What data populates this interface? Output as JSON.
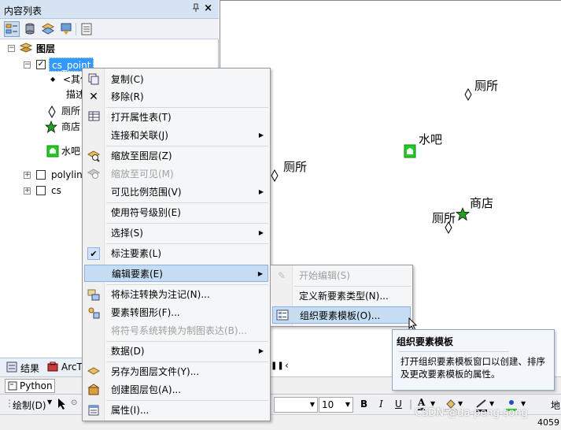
{
  "toc": {
    "title": "内容列表",
    "pin_icon": "pin-icon",
    "close_glyph": "×",
    "layers_root": "图层",
    "layer_cs_point": "cs_point",
    "other_values": "<其他",
    "desc": "描述",
    "legend_toilet": "厕所",
    "legend_shop": "商店",
    "legend_water": "水吧",
    "layer_polyline": "polylin",
    "layer_cs": "cs"
  },
  "bottom_tabs": {
    "results": "结果",
    "arctoolbox": "ArcT"
  },
  "python_tab": "Python",
  "draw_toolbar": {
    "draw_label": "绘制(D)",
    "font_size": "10",
    "bold": "B",
    "italic": "I",
    "underline": "U",
    "font_color": "A",
    "side_label": "地"
  },
  "status": {
    "coord": "4059"
  },
  "map": {
    "labels": [
      {
        "text": "厕所"
      },
      {
        "text": "水吧"
      },
      {
        "text": "厕所"
      },
      {
        "text": "商店"
      },
      {
        "text": "厕所"
      }
    ]
  },
  "context_menu": {
    "items": [
      {
        "label": "复制(C)",
        "icon": "copy-icon"
      },
      {
        "label": "移除(R)",
        "icon": "remove-icon"
      },
      {
        "label": "打开属性表(T)",
        "icon": "table-icon"
      },
      {
        "label": "连接和关联(J)",
        "icon": ""
      },
      {
        "label": "缩放至图层(Z)",
        "icon": "zoom-layer-icon"
      },
      {
        "label": "缩放至可见(M)",
        "icon": "zoom-visible-icon"
      },
      {
        "label": "可见比例范围(V)",
        "icon": ""
      },
      {
        "label": "使用符号级别(E)",
        "icon": ""
      },
      {
        "label": "选择(S)",
        "icon": ""
      },
      {
        "label": "标注要素(L)",
        "icon": "check-icon"
      },
      {
        "label": "编辑要素(E)",
        "icon": ""
      },
      {
        "label": "将标注转换为注记(N)...",
        "icon": "convert-labels-icon"
      },
      {
        "label": "要素转图形(F)...",
        "icon": "features-to-graphics-icon"
      },
      {
        "label": "将符号系统转换为制图表达(B)...",
        "icon": ""
      },
      {
        "label": "数据(D)",
        "icon": ""
      },
      {
        "label": "另存为图层文件(Y)...",
        "icon": "save-layer-icon"
      },
      {
        "label": "创建图层包(A)...",
        "icon": "layer-package-icon"
      },
      {
        "label": "属性(I)...",
        "icon": "properties-icon"
      }
    ]
  },
  "submenu": {
    "items": [
      {
        "label": "开始编辑(S)"
      },
      {
        "label": "定义新要素类型(N)..."
      },
      {
        "label": "组织要素模板(O)..."
      }
    ]
  },
  "tooltip": {
    "title": "组织要素模板",
    "body": "打开组织要素模板窗口以创建、排序及更改要素模板的属性。"
  },
  "watermark": "CSDN @da-peng-song",
  "colors": {
    "highlight": "#c5dcf3",
    "selected_layer": "#3399ff",
    "shop_star": "#22a022",
    "water_icon": "#22cc22"
  }
}
